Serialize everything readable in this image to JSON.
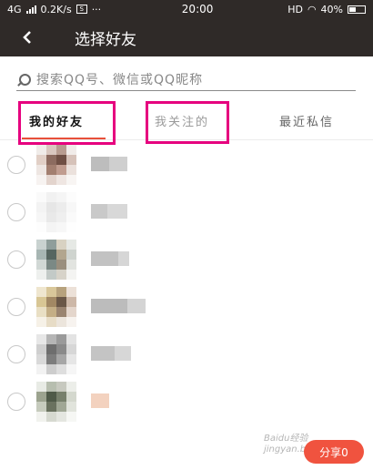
{
  "status": {
    "network": "4G",
    "speed": "0.2K/s",
    "dots": "···",
    "time": "20:00",
    "hd": "HD",
    "battery": "40%"
  },
  "header": {
    "back_icon": "back-arrow-icon",
    "title": "选择好友"
  },
  "search": {
    "placeholder": "搜索QQ号、微信或QQ昵称",
    "value": ""
  },
  "tabs": [
    {
      "label": "我的好友",
      "selected": true
    },
    {
      "label": "我关注的",
      "selected": false
    },
    {
      "label": "最近私信",
      "selected": false
    }
  ],
  "colors": {
    "header_bg": "#2f2a28",
    "accent": "#e8503a",
    "highlight_box": "#e6007e",
    "share_button": "#f0533f"
  },
  "footer": {
    "share_label": "分享0",
    "watermark": "Baidu经验 jingyan.baidu.com"
  }
}
